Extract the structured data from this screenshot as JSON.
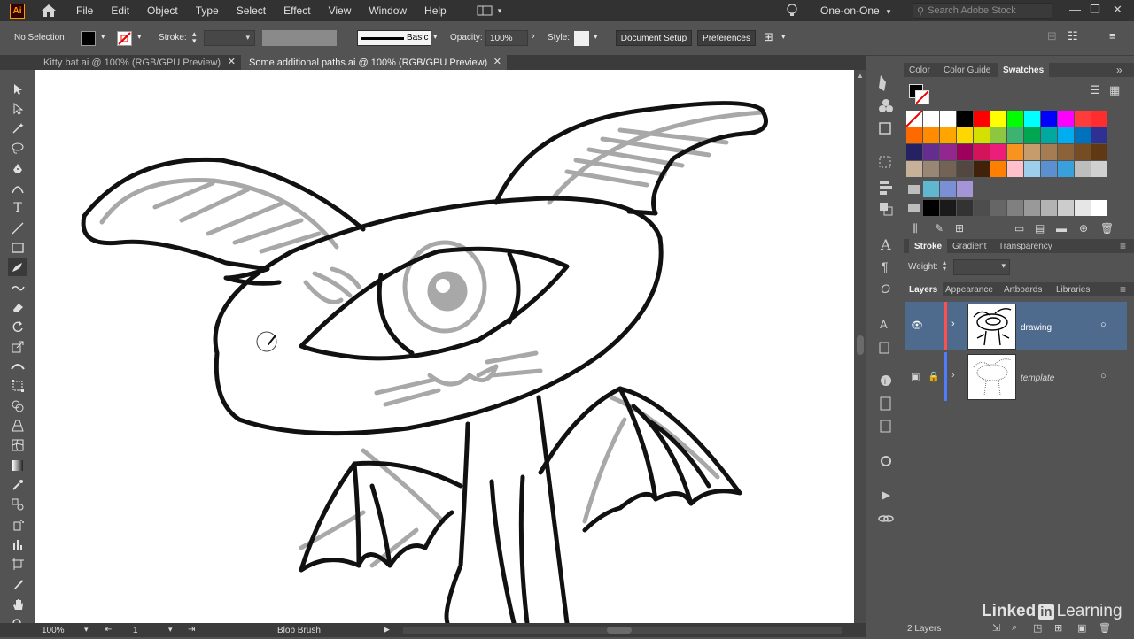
{
  "app": {
    "logo": "Ai"
  },
  "menubar": {
    "items": [
      "File",
      "Edit",
      "Object",
      "Type",
      "Select",
      "Effect",
      "View",
      "Window",
      "Help"
    ],
    "workspace": "One-on-One",
    "search_placeholder": "Search Adobe Stock"
  },
  "control_bar": {
    "selection": "No Selection",
    "stroke_label": "Stroke:",
    "brush_name": "Basic",
    "opacity_label": "Opacity:",
    "opacity_value": "100%",
    "style_label": "Style:",
    "document_setup": "Document Setup",
    "preferences": "Preferences"
  },
  "tabs": [
    {
      "label": "Kitty bat.ai @ 100% (RGB/GPU Preview)",
      "close": "✕",
      "active": false
    },
    {
      "label": "Some additional paths.ai @ 100% (RGB/GPU Preview)",
      "close": "✕",
      "active": true
    }
  ],
  "status": {
    "zoom": "100%",
    "artboard_number": "1",
    "tool_name": "Blob Brush"
  },
  "panels": {
    "top_tabs": [
      "Color",
      "Color Guide",
      "Swatches"
    ],
    "stroke_tabs": [
      "Stroke",
      "Gradient",
      "Transparency"
    ],
    "weight_label": "Weight:",
    "layer_tabs": [
      "Layers",
      "Appearance",
      "Artboards",
      "Libraries"
    ],
    "layers": [
      {
        "name": "drawing",
        "color": "#ff4f4f",
        "selected": true
      },
      {
        "name": "template",
        "color": "#4f7bff",
        "selected": false
      }
    ],
    "layer_count": "2 Layers"
  },
  "swatches": {
    "rows": [
      [
        "#ffffff",
        "#ffffff",
        "#ffffff",
        "#000000",
        "#ff0000",
        "#ffff00",
        "#00ff00",
        "#00ffff",
        "#0000ff",
        "#ff00ff",
        "#ff3b3b",
        "#ff2d2d"
      ],
      [
        "#ff6a00",
        "#ff8c00",
        "#ffa500",
        "#ffd700",
        "#d4e000",
        "#8dc63f",
        "#3cb371",
        "#00a651",
        "#00a99d",
        "#00aeef",
        "#0072bc",
        "#2e3192"
      ],
      [
        "#262262",
        "#662d91",
        "#92278f",
        "#9e005d",
        "#d4145a",
        "#ed1e79",
        "#f7931e",
        "#c69c6d",
        "#a67c52",
        "#8c6239",
        "#754c24",
        "#603813"
      ],
      [
        "#c7b299",
        "#998675",
        "#736357",
        "#534741",
        "#42210b",
        "#ff7f00",
        "#ffc0cb",
        "#9ecfea",
        "#5a8fd0",
        "#3aa0dc",
        "#bdbdbd",
        "#d0d0d0"
      ]
    ],
    "row5": [
      "#5fb8d0",
      "#7b8fd6",
      "#a594d8"
    ],
    "grays": [
      "#000000",
      "#1a1a1a",
      "#333333",
      "#4d4d4d",
      "#666666",
      "#808080",
      "#999999",
      "#b3b3b3",
      "#cccccc",
      "#e6e6e6",
      "#ffffff"
    ]
  },
  "watermark": {
    "brand": "Linked",
    "in": "in",
    "learning": "Learning"
  },
  "colors": {
    "accent": "#4e6a8c",
    "bg": "#535353",
    "menubar": "#323232"
  }
}
